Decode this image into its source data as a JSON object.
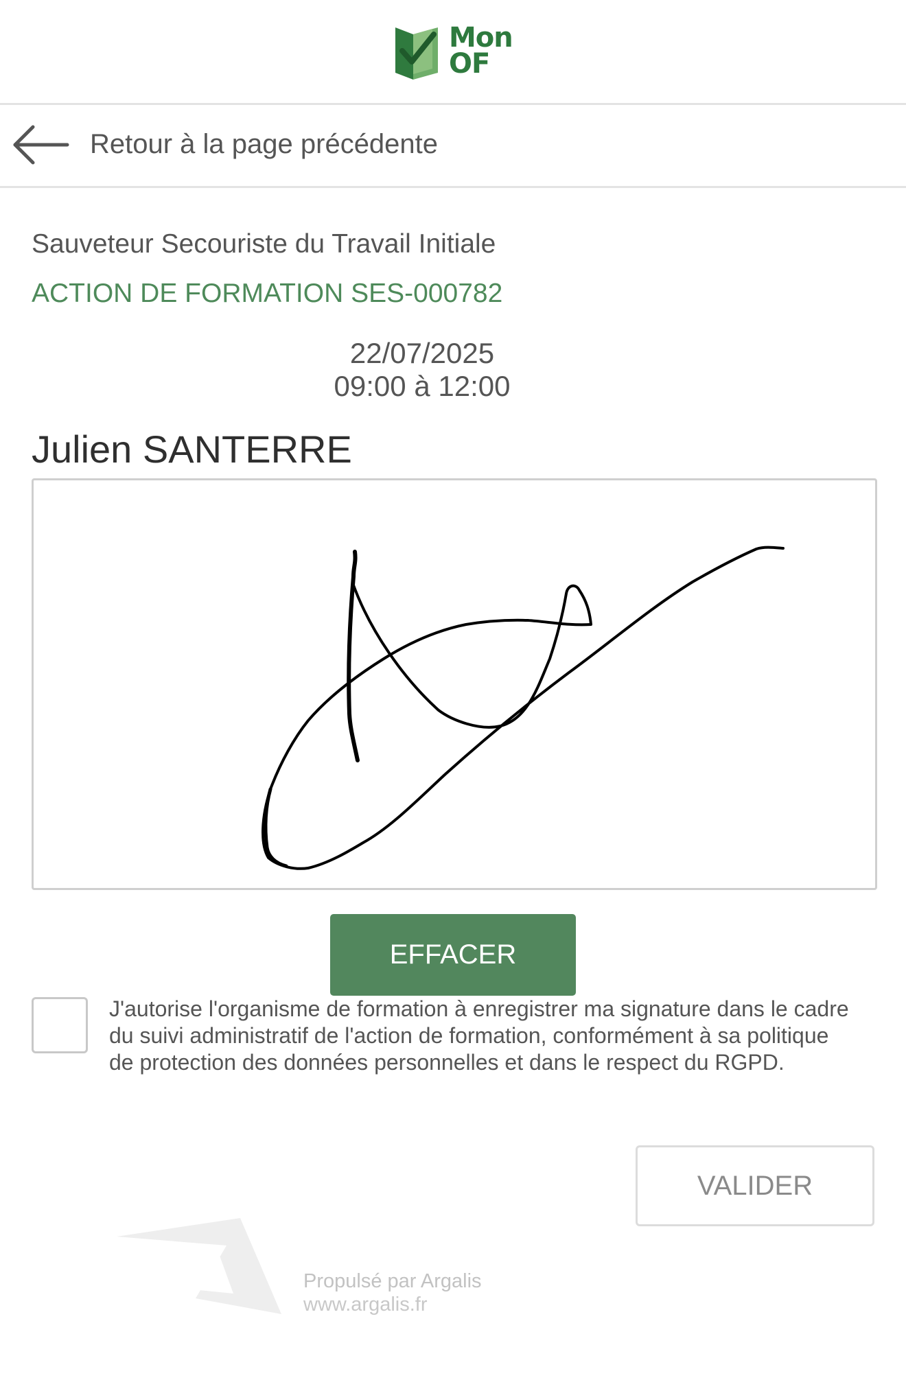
{
  "header": {
    "logo": {
      "line1": "Mon",
      "line2": "OF",
      "icon": "book-check-icon",
      "color": "#2e7a3e"
    }
  },
  "nav": {
    "back_label": "Retour à la page précédente",
    "back_icon": "arrow-left-icon"
  },
  "session": {
    "course_title": "Sauveteur Secouriste du Travail Initiale",
    "action_ref": "ACTION DE FORMATION SES-000782",
    "date": "22/07/2025",
    "time": "09:00 à 12:00"
  },
  "signer": {
    "name": "Julien SANTERRE"
  },
  "signature": {
    "clear_label": "EFFACER"
  },
  "consent": {
    "checked": false,
    "text": "J'autorise l'organisme de formation à enregistrer ma signature dans le cadre du suivi administratif de l'action de formation, conformément à sa politique de protection des données personnelles et dans le respect du RGPD."
  },
  "actions": {
    "validate_label": "VALIDER"
  },
  "footer": {
    "powered_by": "Propulsé par Argalis",
    "url": "www.argalis.fr",
    "logo_icon": "argalis-logo-icon"
  },
  "colors": {
    "accent": "#52875d",
    "action_ref": "#4e8a5a",
    "divider": "#e3e3e3"
  }
}
